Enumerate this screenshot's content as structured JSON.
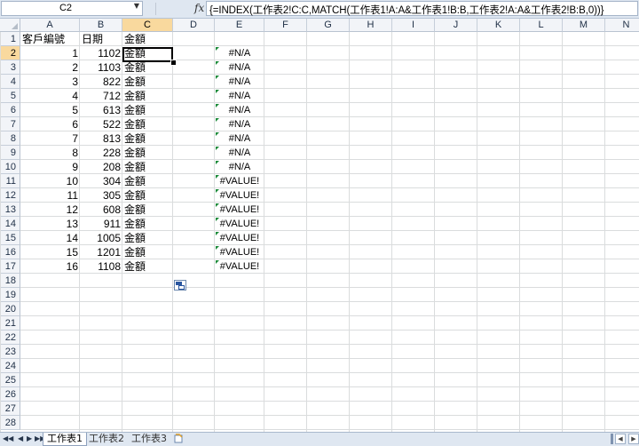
{
  "name_box": {
    "value": "C2",
    "arrow": "▼"
  },
  "formula_bar": {
    "fx_label": "fx",
    "formula": "{=INDEX(工作表2!C:C,MATCH(工作表1!A:A&工作表1!B:B,工作表2!A:A&工作表2!B:B,0))}"
  },
  "columns": [
    "A",
    "B",
    "C",
    "D",
    "E",
    "F",
    "G",
    "H",
    "I",
    "J",
    "K",
    "L",
    "M",
    "N"
  ],
  "rows": [
    "1",
    "2",
    "3",
    "4",
    "5",
    "6",
    "7",
    "8",
    "9",
    "10",
    "11",
    "12",
    "13",
    "14",
    "15",
    "16",
    "17",
    "18",
    "19",
    "20",
    "21",
    "22",
    "23",
    "24",
    "25",
    "26",
    "27",
    "28"
  ],
  "active_cell": {
    "column": "C",
    "row": "2"
  },
  "headers": {
    "A1": "客戶編號",
    "B1": "日期",
    "C1": "金額"
  },
  "data_rows": [
    {
      "A": "1",
      "B": "1102",
      "C": "金額",
      "E": "#N/A"
    },
    {
      "A": "2",
      "B": "1103",
      "C": "金額",
      "E": "#N/A"
    },
    {
      "A": "3",
      "B": "822",
      "C": "金額",
      "E": "#N/A"
    },
    {
      "A": "4",
      "B": "712",
      "C": "金額",
      "E": "#N/A"
    },
    {
      "A": "5",
      "B": "613",
      "C": "金額",
      "E": "#N/A"
    },
    {
      "A": "6",
      "B": "522",
      "C": "金額",
      "E": "#N/A"
    },
    {
      "A": "7",
      "B": "813",
      "C": "金額",
      "E": "#N/A"
    },
    {
      "A": "8",
      "B": "228",
      "C": "金額",
      "E": "#N/A"
    },
    {
      "A": "9",
      "B": "208",
      "C": "金額",
      "E": "#N/A"
    },
    {
      "A": "10",
      "B": "304",
      "C": "金額",
      "E": "#VALUE!"
    },
    {
      "A": "11",
      "B": "305",
      "C": "金額",
      "E": "#VALUE!"
    },
    {
      "A": "12",
      "B": "608",
      "C": "金額",
      "E": "#VALUE!"
    },
    {
      "A": "13",
      "B": "911",
      "C": "金額",
      "E": "#VALUE!"
    },
    {
      "A": "14",
      "B": "1005",
      "C": "金額",
      "E": "#VALUE!"
    },
    {
      "A": "15",
      "B": "1201",
      "C": "金額",
      "E": "#VALUE!"
    },
    {
      "A": "16",
      "B": "1108",
      "C": "金額",
      "E": "#VALUE!"
    }
  ],
  "sheet_tabs": [
    {
      "label": "工作表1",
      "active": true
    },
    {
      "label": "工作表2",
      "active": false
    },
    {
      "label": "工作表3",
      "active": false
    }
  ],
  "sheet_nav": {
    "first": "◀◀",
    "prev": "◀",
    "next": "▶",
    "last": "▶▶"
  },
  "hscroll": {
    "left": "◀",
    "right": "▶"
  },
  "colors": {
    "selected_header": "#f9d99e",
    "error_indicator": "#1c8b3a",
    "header_bg": "#f2f4f8",
    "gridline": "#dadcdd"
  },
  "icons": {
    "paste_options": "paste-options-icon",
    "insert_sheet": "insert-worksheet-icon"
  }
}
